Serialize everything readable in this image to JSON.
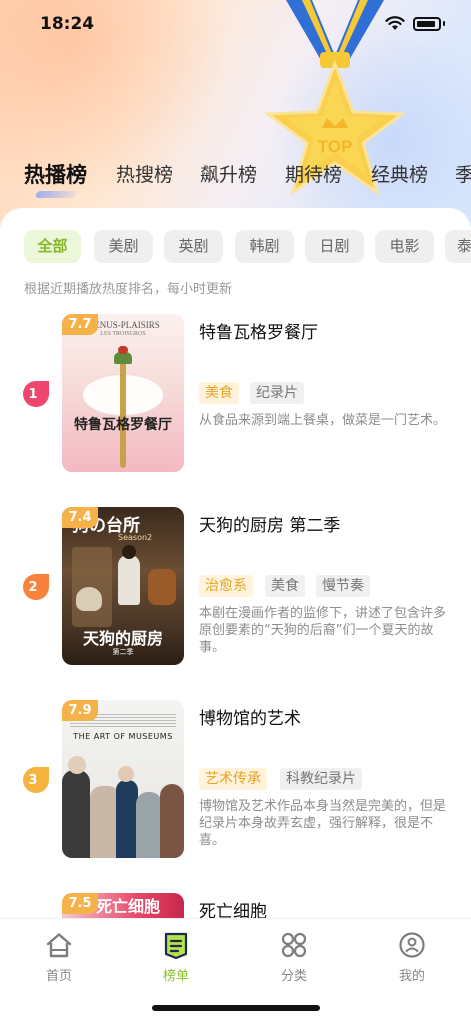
{
  "status_bar": {
    "time": "18:24"
  },
  "top_tabs": [
    {
      "label": "热播榜",
      "active": true
    },
    {
      "label": "热搜榜"
    },
    {
      "label": "飙升榜"
    },
    {
      "label": "期待榜"
    },
    {
      "label": "经典榜"
    },
    {
      "label": "季"
    }
  ],
  "filter_chips": [
    {
      "label": "全部",
      "active": true
    },
    {
      "label": "美剧"
    },
    {
      "label": "英剧"
    },
    {
      "label": "韩剧"
    },
    {
      "label": "日剧"
    },
    {
      "label": "电影"
    },
    {
      "label": "泰"
    }
  ],
  "description": "根据近期播放热度排名，每小时更新",
  "items": [
    {
      "rank": "1",
      "score": "7.7",
      "title": "特鲁瓦格罗餐厅",
      "poster_top": "MENUS-PLAISIRS",
      "poster_sub": "LES TROISGROS",
      "poster_text": "特鲁瓦格罗餐厅",
      "tags": [
        {
          "label": "美食",
          "highlight": true
        },
        {
          "label": "纪录片"
        }
      ],
      "summary": "从食品来源到端上餐桌，做菜是一门艺术。",
      "rank_color": "#f0456f"
    },
    {
      "rank": "2",
      "score": "7.4",
      "title": "天狗的厨房 第二季",
      "poster_top": "狗の台所",
      "poster_sub": "Season2",
      "poster_text": "天狗的厨房",
      "poster_foot": "第二季",
      "tags": [
        {
          "label": "治愈系",
          "highlight": true
        },
        {
          "label": "美食"
        },
        {
          "label": "慢节奏"
        }
      ],
      "summary": "本剧在漫画作者的监修下，讲述了包含许多原创要素的“天狗的后裔”们一个夏天的故事。",
      "rank_color": "#f7823b"
    },
    {
      "rank": "3",
      "score": "7.9",
      "title": "博物馆的艺术",
      "poster_top": "THE ART OF MUSEUMS",
      "tags": [
        {
          "label": "艺术传承",
          "highlight": true
        },
        {
          "label": "科教纪录片"
        }
      ],
      "summary": "博物馆及艺术作品本身当然是完美的，但是纪录片本身故弄玄虚，强行解释，很是不喜。",
      "rank_color": "#f6b340"
    },
    {
      "score": "7.5",
      "title": "死亡细胞",
      "poster_top": "死亡细胞"
    }
  ],
  "bottom_nav": [
    {
      "label": "首页",
      "icon": "home-icon"
    },
    {
      "label": "榜单",
      "icon": "ranking-icon",
      "active": true
    },
    {
      "label": "分类",
      "icon": "category-icon"
    },
    {
      "label": "我的",
      "icon": "profile-icon"
    }
  ],
  "colors": {
    "accent": "#8cbf2b",
    "score_badge": "#f6b24a",
    "tag_highlight": "#e6a324"
  }
}
